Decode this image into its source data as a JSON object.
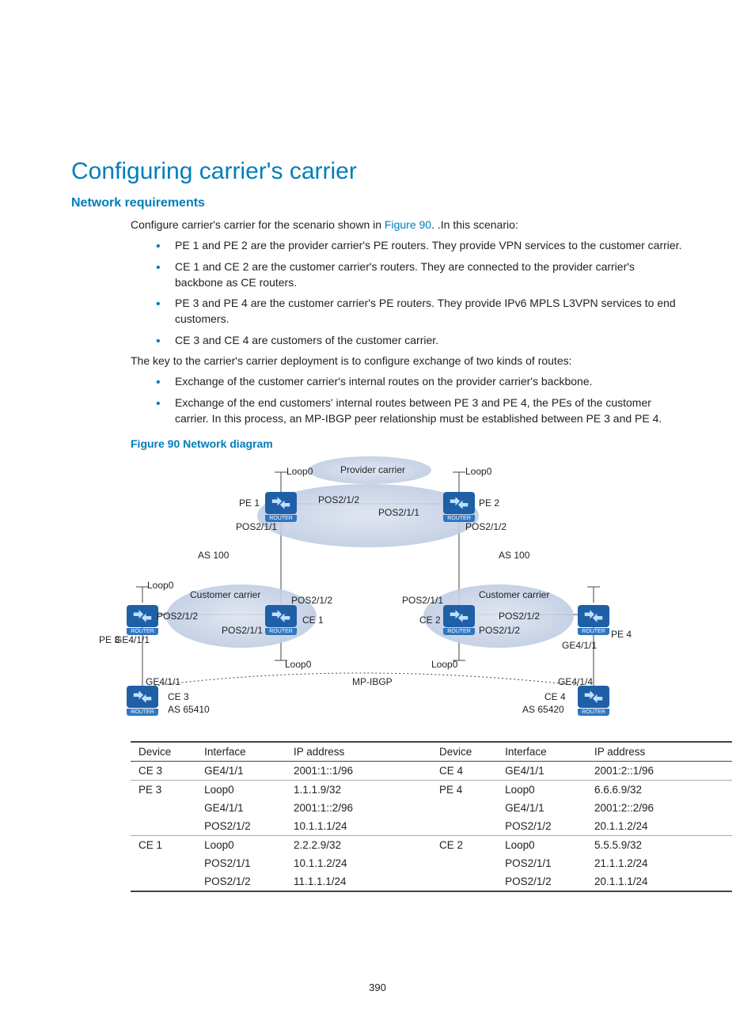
{
  "page_number": "390",
  "h1": "Configuring carrier's carrier",
  "h2": "Network requirements",
  "intro_pre": "Configure carrier's carrier for the scenario shown in ",
  "intro_link": "Figure 90",
  "intro_post": ". .In this scenario:",
  "bullets1": [
    "PE 1 and PE 2 are the provider carrier's PE routers. They provide VPN services to the customer carrier.",
    "CE 1 and CE 2 are the customer carrier's routers. They are connected to the provider carrier's backbone as CE routers.",
    "PE 3 and PE 4 are the customer carrier's PE routers. They provide IPv6 MPLS L3VPN services to end customers.",
    "CE 3 and CE 4 are customers of the customer carrier."
  ],
  "key_para": "The key to the carrier's carrier deployment is to configure exchange of two kinds of routes:",
  "bullets2": [
    "Exchange of the customer carrier's internal routes on the provider carrier's backbone.",
    "Exchange of the end customers' internal routes between PE 3 and PE 4, the PEs of the customer carrier. In this process, an MP-IBGP peer relationship must be established between PE 3 and PE 4."
  ],
  "fig_caption": "Figure 90 Network diagram",
  "diagram": {
    "provider": "Provider carrier",
    "customer": "Customer carrier",
    "loop0": "Loop0",
    "pos212": "POS2/1/2",
    "pos211": "POS2/1/1",
    "pe1": "PE 1",
    "pe2": "PE 2",
    "pe3": "PE 3",
    "pe4": "PE 4",
    "ce1": "CE 1",
    "ce2": "CE 2",
    "ce3": "CE 3",
    "ce4": "CE 4",
    "as100": "AS 100",
    "as65410": "AS 65410",
    "as65420": "AS 65420",
    "ge411": "GE4/1/1",
    "ge414": "GE4/1/4",
    "mpibgp": "MP-IBGP"
  },
  "table": {
    "headers": [
      "Device",
      "Interface",
      "IP address",
      "Device",
      "Interface",
      "IP address"
    ],
    "rows": [
      {
        "sep": true,
        "cells": [
          "CE 3",
          "GE4/1/1",
          "2001:1::1/96",
          "CE 4",
          "GE4/1/1",
          "2001:2::1/96"
        ]
      },
      {
        "sep": true,
        "cells": [
          "PE 3",
          "Loop0",
          "1.1.1.9/32",
          "PE 4",
          "Loop0",
          "6.6.6.9/32"
        ]
      },
      {
        "sep": false,
        "cells": [
          "",
          "GE4/1/1",
          "2001:1::2/96",
          "",
          "GE4/1/1",
          "2001:2::2/96"
        ]
      },
      {
        "sep": false,
        "cells": [
          "",
          "POS2/1/2",
          "10.1.1.1/24",
          "",
          "POS2/1/2",
          "20.1.1.2/24"
        ]
      },
      {
        "sep": true,
        "cells": [
          "CE 1",
          "Loop0",
          "2.2.2.9/32",
          "CE 2",
          "Loop0",
          "5.5.5.9/32"
        ]
      },
      {
        "sep": false,
        "cells": [
          "",
          "POS2/1/1",
          "10.1.1.2/24",
          "",
          "POS2/1/1",
          "21.1.1.2/24"
        ]
      },
      {
        "sep": false,
        "last": true,
        "cells": [
          "",
          "POS2/1/2",
          "11.1.1.1/24",
          "",
          "POS2/1/2",
          "20.1.1.1/24"
        ]
      }
    ]
  }
}
